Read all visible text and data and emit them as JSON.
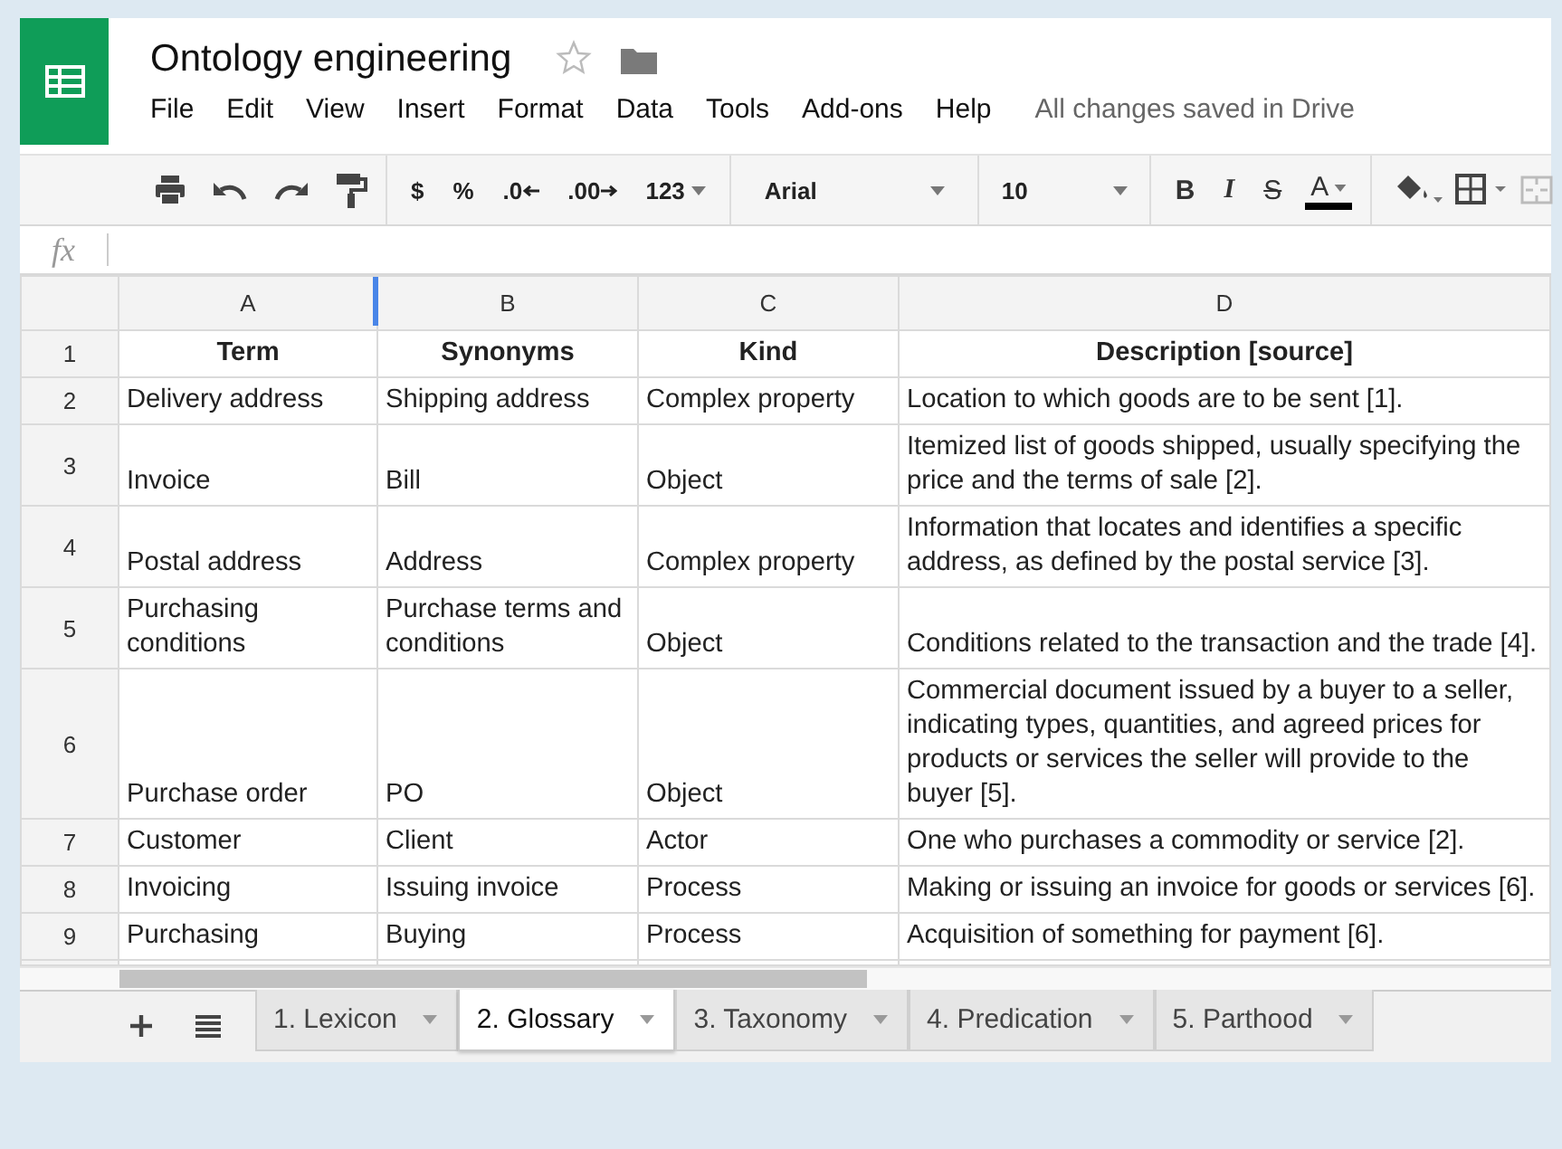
{
  "app": {
    "title": "Ontology engineering",
    "starred": false,
    "menu": [
      "File",
      "Edit",
      "View",
      "Insert",
      "Format",
      "Data",
      "Tools",
      "Add-ons",
      "Help"
    ],
    "save_status": "All changes saved in Drive"
  },
  "toolbar": {
    "number_buttons": [
      {
        "kind": "plain",
        "label": "$"
      },
      {
        "kind": "plain",
        "label": "%"
      },
      {
        "kind": "decrease",
        "label": ".0"
      },
      {
        "kind": "increase",
        "label": ".00"
      },
      {
        "kind": "dropdown",
        "label": "123"
      }
    ],
    "font": "Arial",
    "font_size": "10",
    "format_buttons": [
      {
        "kind": "bold",
        "label": "B"
      },
      {
        "kind": "italic",
        "label": "I"
      },
      {
        "kind": "strike",
        "label": "S"
      },
      {
        "kind": "color",
        "label": "A"
      }
    ]
  },
  "formula_bar": {
    "label": "fx"
  },
  "columns": [
    "A",
    "B",
    "C",
    "D"
  ],
  "rows": [
    {
      "number": "1",
      "header": true,
      "cells": [
        "Term",
        "Synonyms",
        "Kind",
        "Description [source]"
      ]
    },
    {
      "number": "2",
      "header": false,
      "cells": [
        "Delivery address",
        "Shipping address",
        "Complex property",
        "Location to which goods are to be sent [1]."
      ]
    },
    {
      "number": "3",
      "header": false,
      "cells": [
        "Invoice",
        "Bill",
        "Object",
        "Itemized list of goods shipped, usually specifying the price and the terms of sale [2]."
      ]
    },
    {
      "number": "4",
      "header": false,
      "cells": [
        "Postal address",
        "Address",
        "Complex property",
        "Information that locates and identifies a specific address, as defined by the postal service [3]."
      ]
    },
    {
      "number": "5",
      "header": false,
      "cells": [
        "Purchasing conditions",
        "Purchase terms and conditions",
        "Object",
        "Conditions related to the transaction and the trade [4]."
      ]
    },
    {
      "number": "6",
      "header": false,
      "cells": [
        "Purchase order",
        "PO",
        "Object",
        "Commercial document issued by a buyer to a seller, indicating types, quantities, and agreed prices for products or services the seller will provide to the buyer [5]."
      ]
    },
    {
      "number": "7",
      "header": false,
      "cells": [
        "Customer",
        "Client",
        "Actor",
        "One who purchases a commodity or service [2]."
      ]
    },
    {
      "number": "8",
      "header": false,
      "cells": [
        "Invoicing",
        "Issuing invoice",
        "Process",
        "Making or issuing an invoice for goods or services [6]."
      ]
    },
    {
      "number": "9",
      "header": false,
      "cells": [
        "Purchasing",
        "Buying",
        "Process",
        "Acquisition of something for payment [6]."
      ]
    }
  ],
  "sheets": [
    {
      "label": "1. Lexicon",
      "selected": false
    },
    {
      "label": "2. Glossary",
      "selected": true
    },
    {
      "label": "3. Taxonomy",
      "selected": false
    },
    {
      "label": "4. Predication",
      "selected": false
    },
    {
      "label": "5. Parthood",
      "selected": false
    }
  ]
}
